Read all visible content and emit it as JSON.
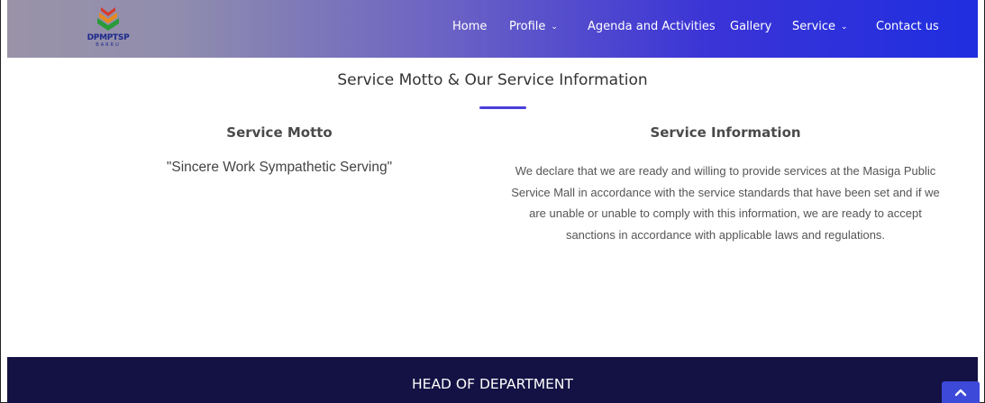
{
  "brand": {
    "logo_text": "DPMPTSP",
    "logo_subtext": "BARRU"
  },
  "nav": {
    "items": [
      {
        "label": "Home",
        "dropdown": false
      },
      {
        "label": "Profile",
        "dropdown": true
      },
      {
        "label": "Agenda and Activities",
        "dropdown": false
      },
      {
        "label": "Gallery",
        "dropdown": false
      },
      {
        "label": "Service",
        "dropdown": true
      },
      {
        "label": "Contact us",
        "dropdown": false
      }
    ]
  },
  "section": {
    "title": "Service Motto & Our Service Information",
    "motto": {
      "heading": "Service Motto",
      "text": "\"Sincere Work Sympathetic Serving\""
    },
    "info": {
      "heading": "Service Information",
      "text": "We declare that we are ready and willing to provide services at the Masiga Public Service Mall in accordance with the service standards that have been set and if we are unable or unable to comply with this information, we are ready to accept sanctions in accordance with applicable laws and regulations."
    }
  },
  "department": {
    "title": "HEAD OF DEPARTMENT"
  },
  "icons": {
    "chevron": "chevron-down-icon",
    "scroll_top": "chevron-up-icon"
  },
  "colors": {
    "nav_start": "#9a93a8",
    "nav_end": "#1f2ee0",
    "accent": "#4a3fdc",
    "band": "#141244",
    "scroll_button": "#3d49d8"
  }
}
